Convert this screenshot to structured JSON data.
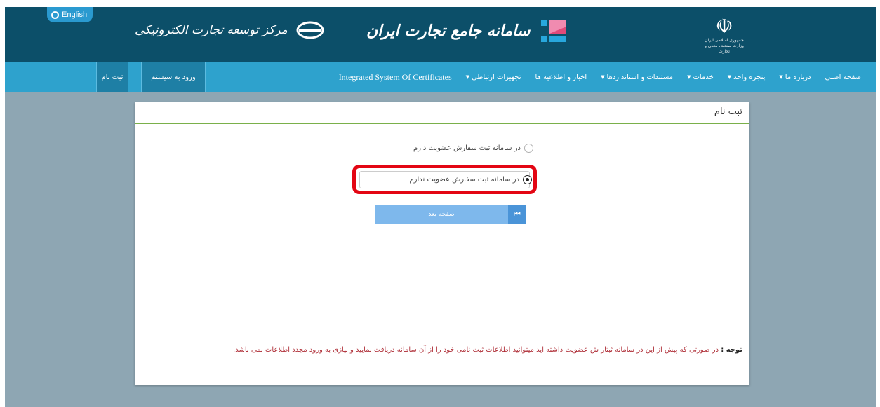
{
  "header": {
    "language_label": "English",
    "left_logo_text": "مرکز توسعه تجارت الکترونیکی",
    "center_logo_text": "سامانه جامع تجارت ایران",
    "emblem_caption": "جمهوری اسلامی ایران وزارت صنعت، معدن و تجارت"
  },
  "nav": {
    "items": [
      {
        "label": "صفحه اصلی",
        "dropdown": false
      },
      {
        "label": "درباره ما",
        "dropdown": true
      },
      {
        "label": "پنجره واحد",
        "dropdown": true
      },
      {
        "label": "خدمات",
        "dropdown": true
      },
      {
        "label": "مستندات و استانداردها",
        "dropdown": true
      },
      {
        "label": "اخبار و اطلاعیه ها",
        "dropdown": false
      },
      {
        "label": "تجهیزات ارتباطی",
        "dropdown": true
      },
      {
        "label": "Integrated System Of Certificates",
        "dropdown": false
      }
    ],
    "login_button": "ورود به سیستم",
    "register_button": "ثبت نام"
  },
  "panel": {
    "title": "ثبت نام",
    "options": [
      {
        "label": "در سامانه ثبت سفارش عضویت دارم",
        "selected": false
      },
      {
        "label": "در سامانه ثبت سفارش عضویت ندارم",
        "selected": true
      }
    ],
    "next_button": "صفحه بعد",
    "note_label": "توجه :",
    "note_text": "در صورتی که پیش از این در سامانه ثبتار ش عضویت داشته اید میتوانید اطلاعات ثبت نامی خود را از آن سامانه دریافت نمایید و نیازی به ورود مجدد اطلاعات نمی باشد."
  },
  "colors": {
    "topbar": "#0c4f69",
    "navbar": "#2ea2cd",
    "background": "#8ea6b3",
    "highlight": "#e30613",
    "next_button": "#7eb8ec",
    "note_text": "#b0313a"
  }
}
